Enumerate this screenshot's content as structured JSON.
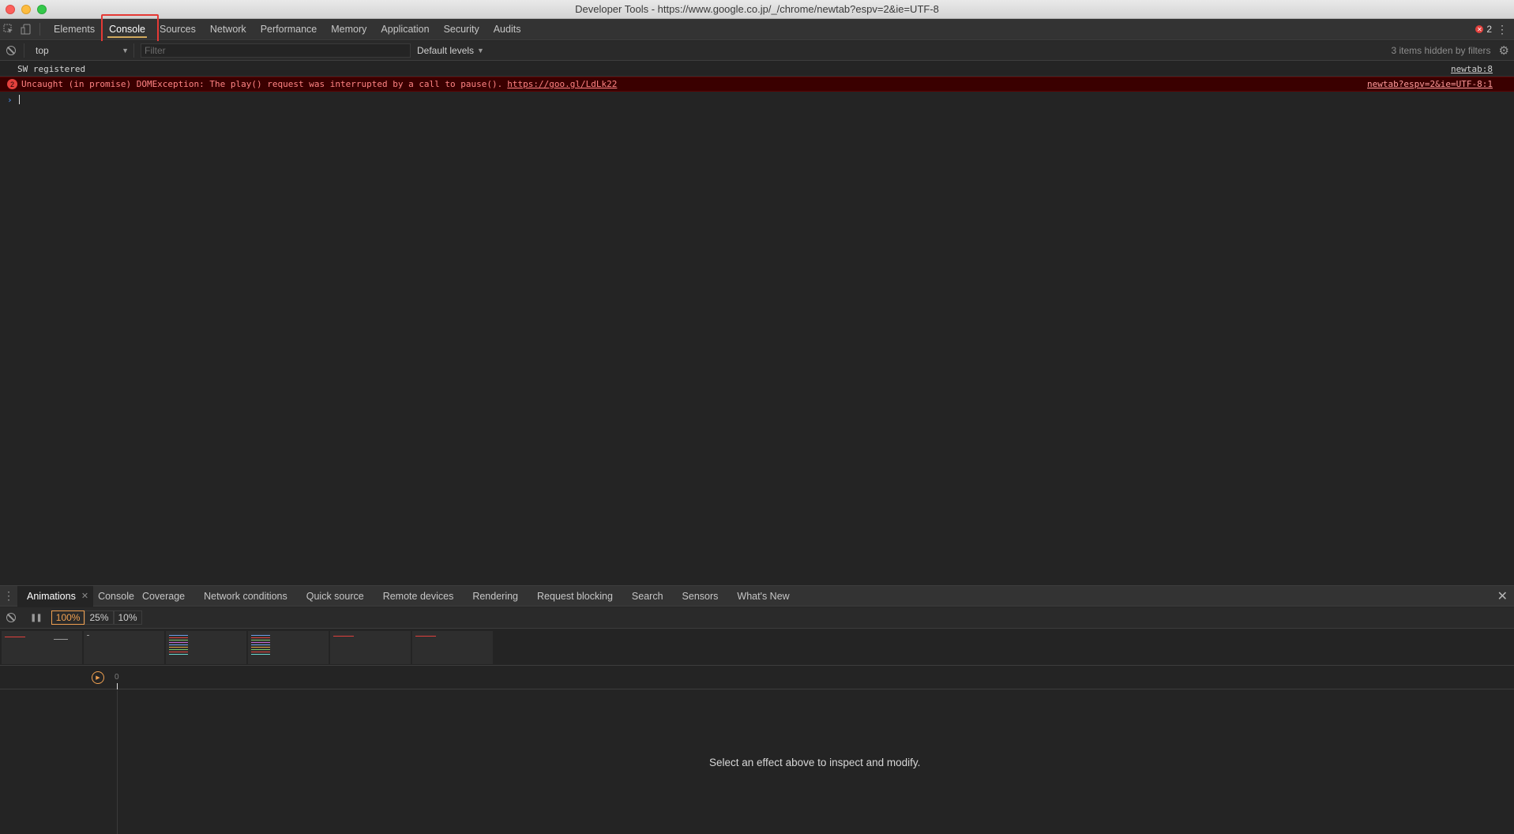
{
  "window": {
    "title": "Developer Tools - https://www.google.co.jp/_/chrome/newtab?espv=2&ie=UTF-8"
  },
  "main_tabs": [
    {
      "label": "Elements",
      "active": false
    },
    {
      "label": "Console",
      "active": true
    },
    {
      "label": "Sources",
      "active": false
    },
    {
      "label": "Network",
      "active": false
    },
    {
      "label": "Performance",
      "active": false
    },
    {
      "label": "Memory",
      "active": false
    },
    {
      "label": "Application",
      "active": false
    },
    {
      "label": "Security",
      "active": false
    },
    {
      "label": "Audits",
      "active": false
    }
  ],
  "error_count": "2",
  "console_toolbar": {
    "context": "top",
    "filter_placeholder": "Filter",
    "filter_value": "",
    "levels": "Default levels",
    "hidden_note": "3 items hidden by filters"
  },
  "messages": [
    {
      "type": "log",
      "text": "SW registered",
      "source": "newtab:8"
    },
    {
      "type": "error",
      "count": "2",
      "text": "Uncaught (in promise) DOMException: The play() request was interrupted by a call to pause().",
      "link": "https://goo.gl/LdLk22",
      "source": "newtab?espv=2&ie=UTF-8:1"
    }
  ],
  "drawer_tabs": [
    {
      "label": "Animations",
      "active": true
    },
    {
      "label": "Console"
    },
    {
      "label": "Coverage"
    },
    {
      "label": "Network conditions"
    },
    {
      "label": "Quick source"
    },
    {
      "label": "Remote devices"
    },
    {
      "label": "Rendering"
    },
    {
      "label": "Request blocking"
    },
    {
      "label": "Search"
    },
    {
      "label": "Sensors"
    },
    {
      "label": "What's New"
    }
  ],
  "playback_rates": [
    {
      "label": "100%",
      "selected": true
    },
    {
      "label": "25%",
      "selected": false
    },
    {
      "label": "10%",
      "selected": false
    }
  ],
  "timeline": {
    "zero_tick": "0",
    "empty_message": "Select an effect above to inspect and modify."
  },
  "colors": {
    "accent": "#f0a050",
    "error_bg": "#3a0000",
    "error_text": "#ff8383",
    "tab_underline": "#d0a85c"
  },
  "icons": [
    "inspect-icon",
    "device-toggle-icon",
    "clear-icon",
    "gear-icon",
    "kebab-icon",
    "close-icon",
    "pause-icon",
    "replay-icon",
    "prompt-chevron-icon"
  ]
}
